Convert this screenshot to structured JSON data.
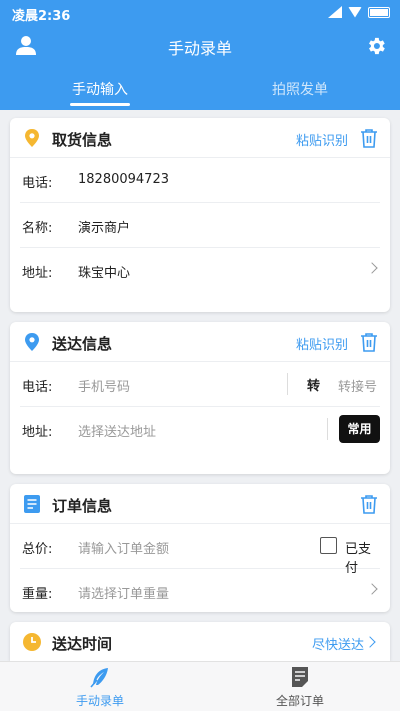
{
  "status_bar": {
    "time": "凌晨2:36"
  },
  "header": {
    "title": "手动录单"
  },
  "tabs": [
    {
      "label": "手动输入",
      "active": true
    },
    {
      "label": "拍照发单",
      "active": false
    }
  ],
  "pickup": {
    "title": "取货信息",
    "paste_label": "粘贴识别",
    "phone_label": "电话:",
    "phone_value": "18280094723",
    "name_label": "名称:",
    "name_value": "演示商户",
    "address_label": "地址:",
    "address_value": "珠宝中心"
  },
  "delivery": {
    "title": "送达信息",
    "paste_label": "粘贴识别",
    "phone_label": "电话:",
    "phone_placeholder": "手机号码",
    "ext_separator": "转",
    "ext_placeholder": "转接号",
    "address_label": "地址:",
    "address_placeholder": "选择送达地址",
    "common_button": "常用"
  },
  "order": {
    "title": "订单信息",
    "price_label": "总价:",
    "price_placeholder": "请输入订单金额",
    "paid_label": "已支付",
    "paid_checked": false,
    "weight_label": "重量:",
    "weight_placeholder": "请选择订单重量"
  },
  "time": {
    "title": "送达时间",
    "value": "尽快送达"
  },
  "bottom_nav": [
    {
      "label": "手动录单",
      "icon": "feather-icon",
      "active": true
    },
    {
      "label": "全部订单",
      "icon": "document-icon",
      "active": false
    }
  ],
  "colors": {
    "accent": "#3d9bf0",
    "pickup_icon": "#f5b731",
    "time_icon": "#f5b731",
    "background": "#eef0f3"
  }
}
